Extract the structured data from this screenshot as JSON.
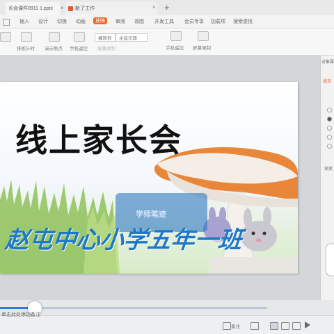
{
  "window": {
    "tabs": [
      {
        "label": "长会课件0911 1.pptx"
      },
      {
        "label": "新了工作"
      }
    ],
    "new_tab_label": "+"
  },
  "menu": {
    "items": [
      "插入",
      "设计",
      "切换",
      "动画",
      "放映",
      "审阅",
      "视图",
      "开发工具",
      "会员专享",
      "加载项",
      "搜索查找"
    ],
    "active": "放映"
  },
  "toolbar": {
    "buttons": [
      "排练计时",
      "演示焦点",
      "手机遥控",
      "屏幕录制"
    ],
    "fields": [
      "播放到",
      "主监示器"
    ],
    "right_buttons": [
      "手机遥控",
      "屏幕录制"
    ]
  },
  "slide": {
    "title": "线上家长会",
    "subtitle": "赵屯中心小学五年一班",
    "watermark": "学师笔迹",
    "colors": {
      "title": "#111111",
      "subtitle": "#1e78c8",
      "mushroom_cap": "#e8873a"
    }
  },
  "right_panel": {
    "header": "对象属",
    "tab": "填充",
    "label": "渐变"
  },
  "progress": {
    "value": 0.13,
    "note_label": "单击此处添加备注"
  },
  "status": {
    "zoom_label": "备注",
    "icons": [
      "notes-icon",
      "comment-icon",
      "normal-view-icon",
      "sorter-view-icon",
      "reading-view-icon",
      "play-icon"
    ]
  }
}
